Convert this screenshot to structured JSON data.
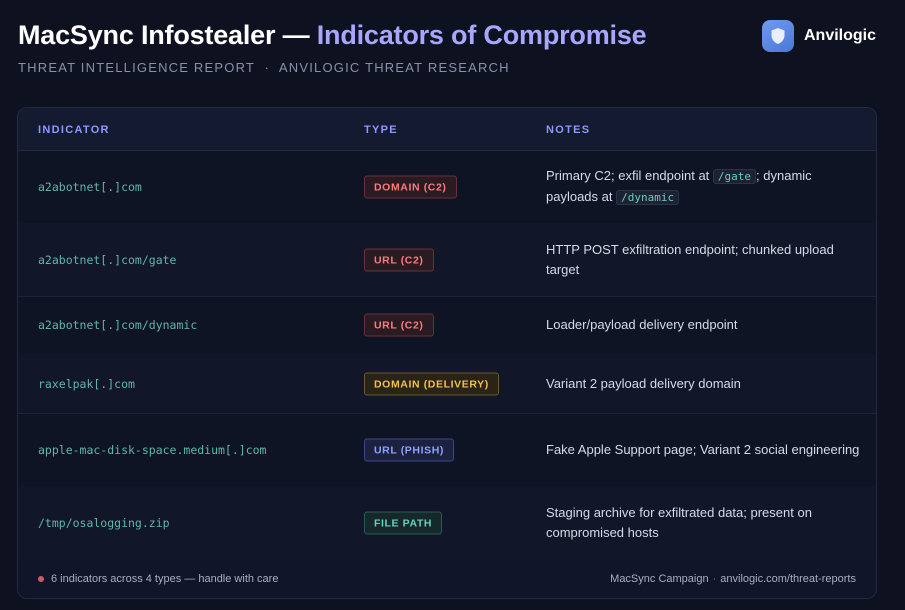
{
  "header": {
    "title_main": "MacSync Infostealer — ",
    "title_accent": "Indicators of Compromise",
    "subtitle": "THREAT INTELLIGENCE REPORT  ·  ANVILOGIC THREAT RESEARCH",
    "brand_name": "Anvilogic",
    "brand_icon": "shield-icon"
  },
  "table": {
    "columns": {
      "indicator": "INDICATOR",
      "type": "TYPE",
      "notes": "NOTES"
    },
    "rows": [
      {
        "indicator": "a2abotnet[.]com",
        "type": "DOMAIN (C2)",
        "type_color": "#ff7a7f",
        "notes_parts": [
          "Primary C2; exfil endpoint at ",
          "/gate",
          "; dynamic payloads at ",
          "/dynamic"
        ]
      },
      {
        "indicator": "a2abotnet[.]com/gate",
        "type": "URL (C2)",
        "type_color": "#ff7a7f",
        "notes": "HTTP POST exfiltration endpoint; chunked upload target"
      },
      {
        "indicator": "a2abotnet[.]com/dynamic",
        "type": "URL (C2)",
        "type_color": "#ff7a7f",
        "notes": "Loader/payload delivery endpoint"
      },
      {
        "indicator": "raxelpak[.]com",
        "type": "DOMAIN (DELIVERY)",
        "type_color": "#f3c14b",
        "notes": "Variant 2 payload delivery domain"
      },
      {
        "indicator": "apple-mac-disk-space.medium[.]com",
        "type": "URL (PHISH)",
        "type_color": "#8fa2ff",
        "notes": "Fake Apple Support page; Variant 2 social engineering"
      },
      {
        "indicator": "/tmp/osalogging.zip",
        "type": "FILE PATH",
        "type_color": "#63d1bb",
        "notes": "Staging archive for exfiltrated data; present on compromised hosts"
      }
    ]
  },
  "footer": {
    "summary": "6 indicators across 4 types — handle with care",
    "campaign": "MacSync Campaign",
    "separator": "·",
    "link": "anvilogic.com/threat-reports"
  }
}
